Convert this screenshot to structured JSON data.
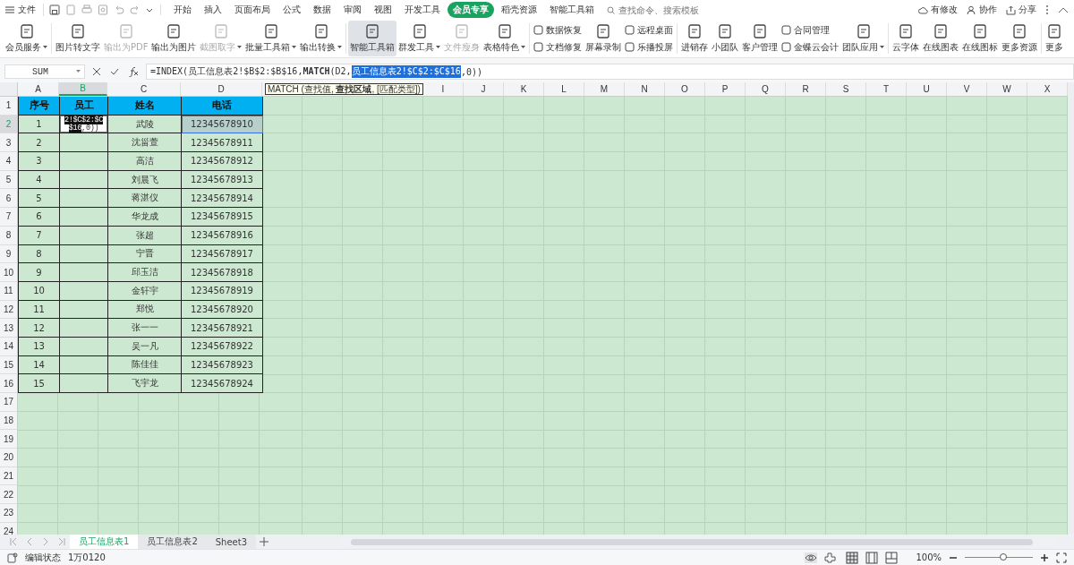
{
  "menu_bar": {
    "file": "文件",
    "tabs": [
      {
        "label": "开始",
        "selected": false
      },
      {
        "label": "插入",
        "selected": false
      },
      {
        "label": "页面布局",
        "selected": false
      },
      {
        "label": "公式",
        "selected": false
      },
      {
        "label": "数据",
        "selected": false
      },
      {
        "label": "审阅",
        "selected": false
      },
      {
        "label": "视图",
        "selected": false
      },
      {
        "label": "开发工具",
        "selected": false
      },
      {
        "label": "会员专享",
        "selected": true
      },
      {
        "label": "稻壳资源",
        "selected": false
      },
      {
        "label": "智能工具箱",
        "selected": false
      }
    ],
    "search": {
      "placeholder": "查找命令、搜索模板"
    },
    "actions": [
      "有修改",
      "协作",
      "分享"
    ]
  },
  "ribbon": {
    "groups": [
      [
        {
          "kind": "big",
          "label": "会员服务",
          "dropdown": true,
          "disabled": false,
          "selected": false
        }
      ],
      [
        {
          "kind": "big",
          "label": "图片转文字",
          "dropdown": false,
          "disabled": false,
          "selected": false
        },
        {
          "kind": "big",
          "label": "输出为PDF",
          "dropdown": false,
          "disabled": true,
          "selected": false
        },
        {
          "kind": "big",
          "label": "输出为图片",
          "dropdown": false,
          "disabled": false,
          "selected": false
        },
        {
          "kind": "big",
          "label": "截图取字",
          "dropdown": true,
          "disabled": true,
          "selected": false
        },
        {
          "kind": "big",
          "label": "批量工具箱",
          "dropdown": true,
          "disabled": false,
          "selected": false
        },
        {
          "kind": "big",
          "label": "输出转换",
          "dropdown": true,
          "disabled": false,
          "selected": false
        }
      ],
      [
        {
          "kind": "big",
          "label": "智能工具箱",
          "dropdown": false,
          "disabled": false,
          "selected": true
        },
        {
          "kind": "big",
          "label": "群发工具",
          "dropdown": true,
          "disabled": false,
          "selected": false
        },
        {
          "kind": "big",
          "label": "文件瘦身",
          "dropdown": false,
          "disabled": true,
          "selected": false
        },
        {
          "kind": "big",
          "label": "表格特色",
          "dropdown": true,
          "disabled": false,
          "selected": false
        }
      ],
      [
        {
          "kind": "pair",
          "items": [
            {
              "label": "数据恢复"
            },
            {
              "label": "文档修复"
            }
          ]
        },
        {
          "kind": "big",
          "label": "屏幕录制",
          "dropdown": false,
          "disabled": false,
          "selected": false
        },
        {
          "kind": "pair",
          "items": [
            {
              "label": "远程桌面"
            },
            {
              "label": "乐播投屏"
            }
          ]
        }
      ],
      [
        {
          "kind": "big",
          "label": "进销存",
          "dropdown": false,
          "disabled": false,
          "selected": false
        },
        {
          "kind": "big",
          "label": "小团队",
          "dropdown": false,
          "disabled": false,
          "selected": false
        },
        {
          "kind": "big",
          "label": "客户管理",
          "dropdown": false,
          "disabled": false,
          "selected": false
        },
        {
          "kind": "pair",
          "items": [
            {
              "label": "合同管理"
            },
            {
              "label": "金蝶云会计"
            }
          ]
        },
        {
          "kind": "big",
          "label": "团队应用",
          "dropdown": true,
          "disabled": false,
          "selected": false
        }
      ],
      [
        {
          "kind": "big",
          "label": "云字体",
          "dropdown": false,
          "disabled": false,
          "selected": false
        },
        {
          "kind": "big",
          "label": "在线图表",
          "dropdown": false,
          "disabled": false,
          "selected": false
        },
        {
          "kind": "big",
          "label": "在线图标",
          "dropdown": false,
          "disabled": false,
          "selected": false
        },
        {
          "kind": "big",
          "label": "更多资源",
          "dropdown": false,
          "disabled": false,
          "selected": false
        }
      ],
      [
        {
          "kind": "big",
          "label": "更多",
          "dropdown": false,
          "disabled": false,
          "selected": false
        }
      ]
    ]
  },
  "formula_bar": {
    "name_box": "SUM",
    "formula": "=INDEX(员工信息表2!$B$2:$B$16,**MATCH**(D2,",
    "formula_selected": "员工信息表2!$C$2:$C$16",
    "formula_rest": ",0))"
  },
  "sheet": {
    "columns_left": [
      {
        "label": "A",
        "selected": false
      },
      {
        "label": "B",
        "selected": true
      },
      {
        "label": "C",
        "selected": false
      },
      {
        "label": "D",
        "selected": false
      }
    ],
    "tooltip": "MATCH (查找值, **查找区域**, [匹配类型])",
    "columns_right": [
      {
        "label": "I",
        "selected": false
      },
      {
        "label": "J",
        "selected": false
      },
      {
        "label": "K",
        "selected": false
      },
      {
        "label": "L",
        "selected": false
      },
      {
        "label": "M",
        "selected": false
      },
      {
        "label": "N",
        "selected": false
      },
      {
        "label": "O",
        "selected": false
      },
      {
        "label": "P",
        "selected": false
      },
      {
        "label": "Q",
        "selected": false
      },
      {
        "label": "R",
        "selected": false
      },
      {
        "label": "S",
        "selected": false
      },
      {
        "label": "T",
        "selected": false
      },
      {
        "label": "U",
        "selected": false
      },
      {
        "label": "V",
        "selected": false
      },
      {
        "label": "W",
        "selected": false
      },
      {
        "label": "X",
        "selected": false
      }
    ],
    "row_headers": [
      {
        "label": "1",
        "selected": false
      },
      {
        "label": "2",
        "selected": true
      },
      {
        "label": "3",
        "selected": false
      },
      {
        "label": "4",
        "selected": false
      },
      {
        "label": "5",
        "selected": false
      },
      {
        "label": "6",
        "selected": false
      },
      {
        "label": "7",
        "selected": false
      },
      {
        "label": "8",
        "selected": false
      },
      {
        "label": "9",
        "selected": false
      },
      {
        "label": "10",
        "selected": false
      },
      {
        "label": "11",
        "selected": false
      },
      {
        "label": "12",
        "selected": false
      },
      {
        "label": "13",
        "selected": false
      },
      {
        "label": "14",
        "selected": false
      },
      {
        "label": "15",
        "selected": false
      },
      {
        "label": "16",
        "selected": false
      },
      {
        "label": "17",
        "selected": false
      },
      {
        "label": "18",
        "selected": false
      },
      {
        "label": "19",
        "selected": false
      },
      {
        "label": "20",
        "selected": false
      },
      {
        "label": "21",
        "selected": false
      },
      {
        "label": "22",
        "selected": false
      },
      {
        "label": "23",
        "selected": false
      },
      {
        "label": "24",
        "selected": false
      }
    ],
    "header": [
      "序号",
      "员工",
      "姓名",
      "电话"
    ],
    "editing_cell": {
      "selected": "2!$C$2:$C$16",
      "rest": ",0))"
    },
    "rows": [
      {
        "no": "1",
        "name": "武陵",
        "phone": "12345678910",
        "highlighted": true
      },
      {
        "no": "2",
        "name": "沈甾萱",
        "phone": "12345678911",
        "highlighted": false
      },
      {
        "no": "3",
        "name": "高洁",
        "phone": "12345678912",
        "highlighted": false
      },
      {
        "no": "4",
        "name": "刘晨飞",
        "phone": "12345678913",
        "highlighted": false
      },
      {
        "no": "5",
        "name": "蒋湛仪",
        "phone": "12345678914",
        "highlighted": false
      },
      {
        "no": "6",
        "name": "华龙成",
        "phone": "12345678915",
        "highlighted": false
      },
      {
        "no": "7",
        "name": "张超",
        "phone": "12345678916",
        "highlighted": false
      },
      {
        "no": "8",
        "name": "宁晋",
        "phone": "12345678917",
        "highlighted": false
      },
      {
        "no": "9",
        "name": "邱玉洁",
        "phone": "12345678918",
        "highlighted": false
      },
      {
        "no": "10",
        "name": "金轩宇",
        "phone": "12345678919",
        "highlighted": false
      },
      {
        "no": "11",
        "name": "郑悦",
        "phone": "12345678920",
        "highlighted": false
      },
      {
        "no": "12",
        "name": "张一一",
        "phone": "12345678921",
        "highlighted": false
      },
      {
        "no": "13",
        "name": "吴一凡",
        "phone": "12345678922",
        "highlighted": false
      },
      {
        "no": "14",
        "name": "陈佳佳",
        "phone": "12345678923",
        "highlighted": false
      },
      {
        "no": "15",
        "name": "飞宇龙",
        "phone": "12345678924",
        "highlighted": false
      }
    ]
  },
  "sheet_tabs": [
    {
      "label": "员工信息表1",
      "selected": true
    },
    {
      "label": "员工信息表2",
      "selected": false
    },
    {
      "label": "Sheet3",
      "selected": false
    }
  ],
  "status_bar": {
    "mode": "编辑状态",
    "value": "1万0120",
    "zoom": "100%",
    "level": 0.56
  }
}
